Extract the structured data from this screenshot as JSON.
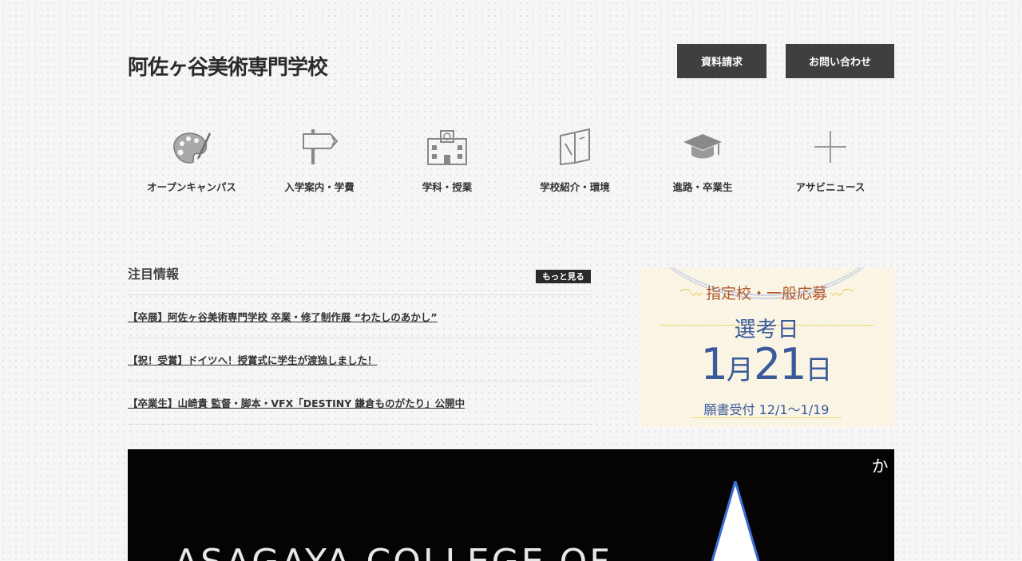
{
  "header": {
    "logo": "阿佐ヶ谷美術専門学校",
    "request_label": "資料請求",
    "contact_label": "お問い合わせ"
  },
  "nav": [
    {
      "label": "オープンキャンパス",
      "icon": "palette-icon"
    },
    {
      "label": "入学案内・学費",
      "icon": "signpost-icon"
    },
    {
      "label": "学科・授業",
      "icon": "school-building-icon"
    },
    {
      "label": "学校紹介・環境",
      "icon": "book-icon"
    },
    {
      "label": "進路・卒業生",
      "icon": "graduation-cap-icon"
    },
    {
      "label": "アサビニュース",
      "icon": "plus-icon"
    }
  ],
  "news": {
    "title": "注目情報",
    "more_label": "もっと見る",
    "items": [
      "【卒展】阿佐ヶ谷美術専門学校 卒業・修了制作展 “わたしのあかし”",
      "【祝！受賞】ドイツへ！授賞式に学生が渡独しました！",
      "【卒業生】山崎貴 監督・脚本・VFX「DESTINY 鎌倉ものがたり」公開中"
    ]
  },
  "banner": {
    "heading": "指定校・一般応募",
    "subheading": "選考日",
    "date_month": "1",
    "date_month_unit": "月",
    "date_day": "21",
    "date_day_unit": "日",
    "note": "願書受付 12/1〜1/19"
  },
  "hero": {
    "title": "ASAGAYA COLLEGE OF",
    "vertical_text": "わたしのあか"
  },
  "colors": {
    "button_bg": "#3f3f3f",
    "banner_blue": "#3a5a9a",
    "banner_orange": "#b25a2c",
    "banner_gold": "#f0d768"
  }
}
